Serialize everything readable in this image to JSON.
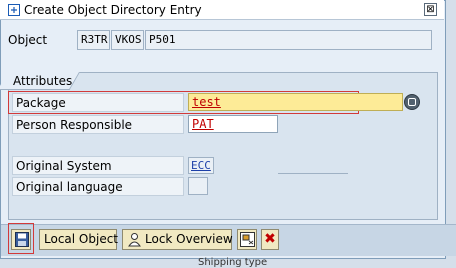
{
  "window": {
    "title": "Create Object Directory Entry",
    "close_label": "⊠"
  },
  "object": {
    "label": "Object",
    "pgmid": "R3TR",
    "type": "VKOS",
    "name": "P501"
  },
  "attributes": {
    "group_title": "Attributes",
    "package_label": "Package",
    "package_value": "test",
    "person_label": "Person Responsible",
    "person_value": "PAT",
    "original_system_label": "Original System",
    "original_system_value": "ECC",
    "original_language_label": "Original language",
    "original_language_value": ""
  },
  "toolbar": {
    "local_object_label": "Local Object",
    "lock_overview_label": "Lock Overview",
    "cancel_label": "✖"
  },
  "background": {
    "partial_text": "Shipping type"
  },
  "colors": {
    "required_field": "#fdeb97",
    "highlight_border": "#d23a3a",
    "button_bg": "#f1e9c2"
  }
}
